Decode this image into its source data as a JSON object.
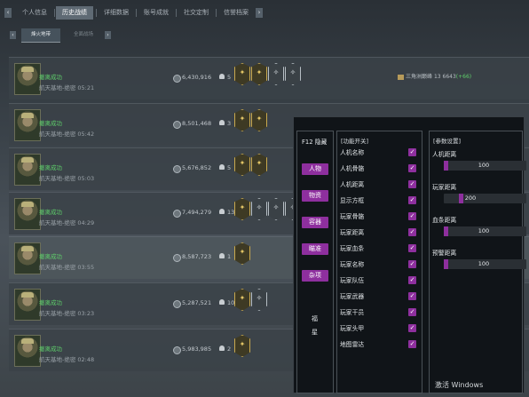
{
  "nav": {
    "tabs": [
      {
        "label": "个人信息",
        "active": false
      },
      {
        "label": "历史战绩",
        "active": true
      },
      {
        "label": "详细数据",
        "active": false
      },
      {
        "label": "账号成就",
        "active": false
      },
      {
        "label": "社交定制",
        "active": false
      },
      {
        "label": "信誉档案",
        "active": false
      }
    ],
    "prev_icon": "chevron-left-icon",
    "next_icon": "chevron-right-icon"
  },
  "subnav": {
    "tabs": [
      {
        "label": "烽火地带",
        "active": true
      },
      {
        "label": "全面战场",
        "active": false
      }
    ]
  },
  "matches": [
    {
      "status": "撤离成功",
      "map": "航天基地-绝密 05:21",
      "money": "6,430,916",
      "kills": "5",
      "badges": [
        "gold",
        "gold",
        "silver",
        "silver"
      ],
      "extra": {
        "text": "三角洲巅峰",
        "count": "13",
        "score": "6643",
        "delta": "(+66)"
      }
    },
    {
      "status": "撤离成功",
      "map": "航天基地-绝密 05:42",
      "money": "8,501,468",
      "kills": "3",
      "badges": [
        "gold",
        "gold"
      ],
      "extra": null
    },
    {
      "status": "撤离成功",
      "map": "航天基地-绝密 05:03",
      "money": "5,676,852",
      "kills": "5",
      "badges": [
        "gold",
        "gold"
      ],
      "extra": null
    },
    {
      "status": "撤离成功",
      "map": "航天基地-绝密 04:29",
      "money": "7,494,279",
      "kills": "13",
      "badges": [
        "gold",
        "silver",
        "silver",
        "silver"
      ],
      "extra": null
    },
    {
      "status": "撤离成功",
      "map": "航天基地-绝密 03:55",
      "money": "8,587,723",
      "kills": "1",
      "badges": [
        "gold"
      ],
      "extra": null,
      "highlight": true
    },
    {
      "status": "撤离成功",
      "map": "航天基地-绝密 03:23",
      "money": "5,287,521",
      "kills": "10",
      "badges": [
        "gold",
        "silver"
      ],
      "extra": null
    },
    {
      "status": "撤离成功",
      "map": "航天基地-绝密 02:48",
      "money": "5,983,985",
      "kills": "2",
      "badges": [
        "gold"
      ],
      "extra": null
    }
  ],
  "panel": {
    "hotkey": "F12 隐藏",
    "categories": [
      "人物",
      "物资",
      "容器",
      "瞄准",
      "杂项"
    ],
    "side_text_1": "福",
    "side_text_2": "星",
    "features_title": "[功能开关]",
    "features": [
      "人机名称",
      "人机骨骼",
      "人机距离",
      "显示方框",
      "玩家骨骼",
      "玩家距离",
      "玩家血条",
      "玩家名称",
      "玩家队伍",
      "玩家武器",
      "玩家干员",
      "玩家头甲",
      "地图雷达"
    ],
    "checked_mark": "✓",
    "params_title": "[参数设置]",
    "params": [
      {
        "label": "人机距离",
        "value": "100",
        "fraction": 0.0
      },
      {
        "label": "玩家距离",
        "value": "200",
        "fraction": 0.19
      },
      {
        "label": "血条距离",
        "value": "100",
        "fraction": 0.0
      },
      {
        "label": "预警距离",
        "value": "100",
        "fraction": 0.0
      }
    ]
  },
  "bottom": {
    "activate": "激活 Windows"
  },
  "colors": {
    "accent": "#8e2f9e",
    "success": "#5fd06b",
    "gold": "#c9a94e"
  }
}
